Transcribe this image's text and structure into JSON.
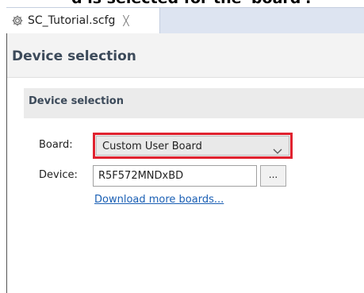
{
  "caption": {
    "text": "d is selected for the 'board'."
  },
  "tab": {
    "title": "SC_Tutorial.scfg",
    "close_symbol": "╳",
    "icon": "gear-icon"
  },
  "page": {
    "title": "Device selection"
  },
  "section": {
    "title": "Device selection"
  },
  "board": {
    "label": "Board:",
    "value": "Custom User Board",
    "icon": "chevron-down-icon"
  },
  "device": {
    "label": "Device:",
    "value": "R5F572MNDxBD",
    "browse_label": "..."
  },
  "link": {
    "text": "Download more boards..."
  },
  "colors": {
    "highlight": "#e0222f",
    "link": "#1a5fb4",
    "heading": "#3c4a5a",
    "tab_bar": "#dde4f1"
  }
}
